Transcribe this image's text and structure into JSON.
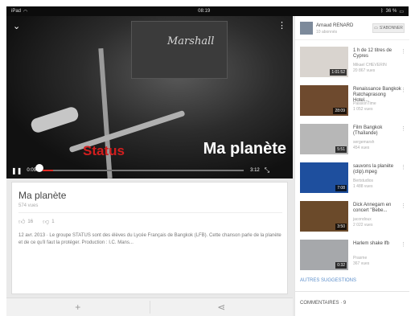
{
  "status_bar": {
    "device": "iPad",
    "time": "08:19",
    "battery": "36 %"
  },
  "video": {
    "brand_on_amp": "Marshall",
    "overlay_status": "Status",
    "overlay_title": "Ma planète",
    "current_time": "0:09",
    "duration": "3:12",
    "progress_fraction": 0.05
  },
  "info": {
    "title": "Ma planète",
    "views": "574 vues",
    "likes": "16",
    "dislikes": "1",
    "description": "12 avr. 2013 · Le groupe STATUS sont des élèves du Lycée Français de Bangkok (LFB). Cette chanson parle de la planète et de ce qu'il faut la protéger. Production : I.C. Mans..."
  },
  "channel": {
    "name": "Arnaud RENARD",
    "subscribers": "10 abonnés",
    "subscribe_label": "S'ABONNER"
  },
  "suggestions": [
    {
      "title": "1 h de 12 titres de Cypres",
      "channel": "Mikael CHEVERIN",
      "views": "20 867 vues",
      "duration": "1:01:52",
      "thumb_bg": "#d9d4cf"
    },
    {
      "title": "Renaissance Bangkok Ratchaprasong Hotel...",
      "channel": "PassionTime",
      "views": "1 052 vues",
      "duration": "28:09",
      "thumb_bg": "#6e4a2e"
    },
    {
      "title": "Film Bangkok (Thaïlande)",
      "channel": "sergemarsh",
      "views": "454 vues",
      "duration": "5:51",
      "thumb_bg": "#b7b7b7"
    },
    {
      "title": "sauvons la planète (clip).mpeg",
      "channel": "Bertstudios",
      "views": "1 488 vues",
      "duration": "7:08",
      "thumb_bg": "#1e4f9e"
    },
    {
      "title": "Dick Annegarn en concert \"Bebe...",
      "channel": "jacondoux",
      "views": "2 022 vues",
      "duration": "3:50",
      "thumb_bg": "#6b4a2a"
    },
    {
      "title": "Harlem shake lfb",
      "channel": "Prasme",
      "views": "367 vues",
      "duration": "0:32",
      "thumb_bg": "#a6a8ab"
    }
  ],
  "more_suggestions_label": "AUTRES SUGGESTIONS",
  "comments": {
    "label": "COMMENTAIRES",
    "separator": "·",
    "count": "9"
  }
}
